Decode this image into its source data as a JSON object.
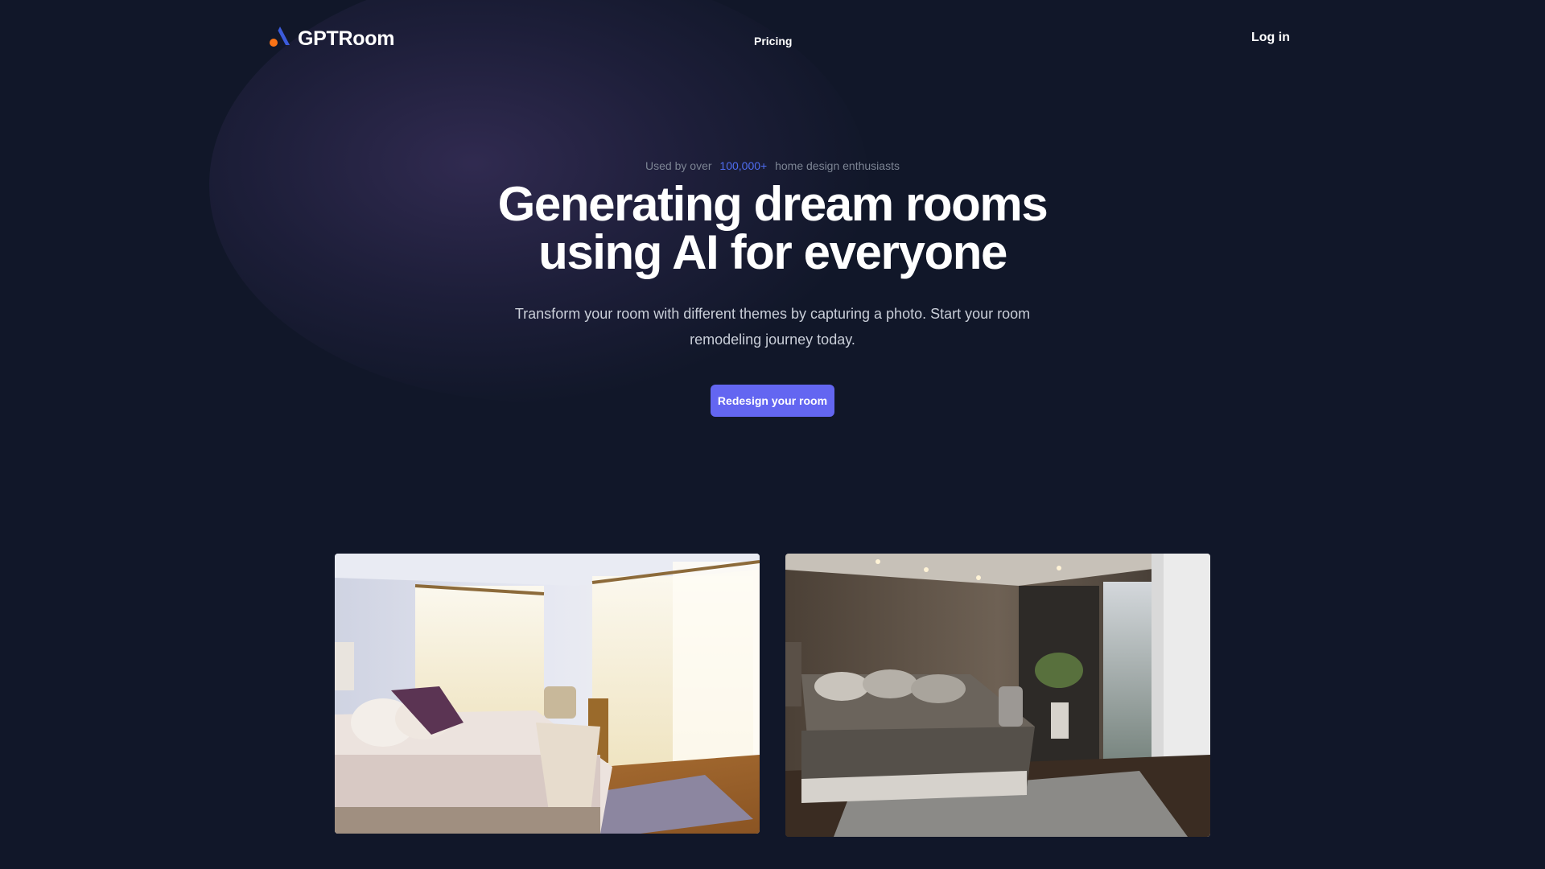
{
  "header": {
    "brand": "GPTRoom",
    "nav_pricing": "Pricing",
    "login": "Log in"
  },
  "hero": {
    "used_by_prefix": "Used by over",
    "used_by_count": "100,000+",
    "used_by_suffix": "home design enthusiasts",
    "headline_line1": "Generating dream rooms",
    "headline_line2": "using AI for everyone",
    "subtext": "Transform your room with different themes by capturing a photo. Start your room remodeling journey today.",
    "cta_label": "Redesign your room"
  },
  "images": {
    "original": "bright bedroom photo",
    "generated": "dark modern bedroom render"
  },
  "colors": {
    "background": "#111729",
    "accent": "#6366f1",
    "highlight": "#4f6df0",
    "logo_blue": "#3b5bdb",
    "logo_orange": "#f97316"
  }
}
